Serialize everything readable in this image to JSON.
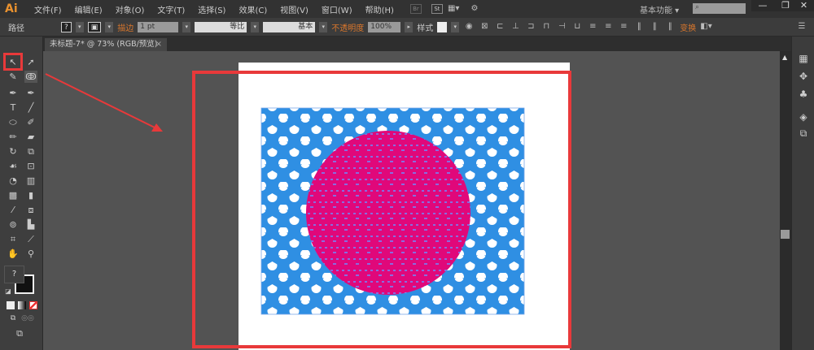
{
  "app": {
    "logo": "Ai"
  },
  "menu": [
    "文件(F)",
    "编辑(E)",
    "对象(O)",
    "文字(T)",
    "选择(S)",
    "效果(C)",
    "视图(V)",
    "窗口(W)",
    "帮助(H)"
  ],
  "menu_buttons": {
    "br": "Br",
    "st": "St"
  },
  "workspace": "基本功能",
  "window_controls": {
    "minimize": "—",
    "restore": "❐",
    "close": "✕"
  },
  "control": {
    "object_type": "路径",
    "fill": "?",
    "stroke_label": "描边",
    "stroke_weight": "1 pt",
    "profile": "等比",
    "brush": "基本",
    "opacity_label": "不透明度",
    "opacity": "100%",
    "style_label": "样式",
    "transform": "变换"
  },
  "document_tab": {
    "title": "未标题-7* @ 73% (RGB/预览)",
    "close": "×"
  },
  "tools": {
    "unknown_fill": "?"
  },
  "colors": {
    "highlight": "#e8393a",
    "pattern_blue": "#2f8fe3",
    "circle": "#e0087a",
    "circle_dots": "#8a6be0"
  }
}
